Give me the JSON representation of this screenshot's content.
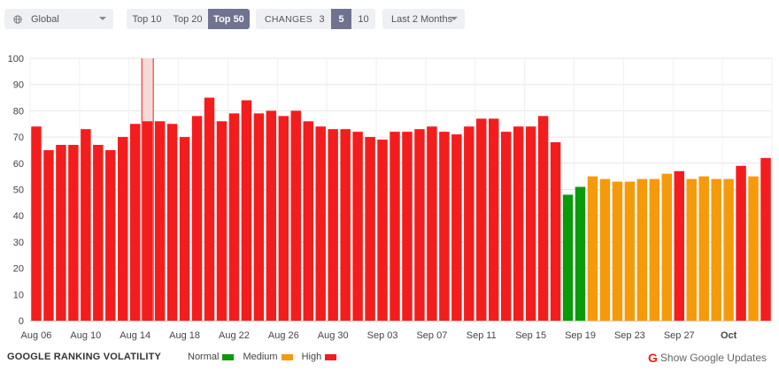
{
  "controls": {
    "region": {
      "label": "Global",
      "icon": "globe-icon"
    },
    "top_options": [
      {
        "label": "Top 10",
        "active": false
      },
      {
        "label": "Top 20",
        "active": false
      },
      {
        "label": "Top 50",
        "active": true
      }
    ],
    "changes": {
      "label": "CHANGES",
      "options": [
        {
          "label": "3",
          "active": false
        },
        {
          "label": "5",
          "active": true
        },
        {
          "label": "10",
          "active": false
        }
      ]
    },
    "period": {
      "label": "Last 2 Months"
    }
  },
  "colors": {
    "normal": "#0a9a0a",
    "medium": "#f59a0a",
    "high": "#f31d1d",
    "highlight": "#f5dada",
    "grid": "#e6e6e6"
  },
  "chart_data": {
    "type": "bar",
    "title": "GOOGLE RANKING VOLATILITY",
    "ylim": [
      0,
      100
    ],
    "yticks": [
      0,
      10,
      20,
      30,
      40,
      50,
      60,
      70,
      80,
      90,
      100
    ],
    "grid": true,
    "values": [
      74,
      65,
      67,
      67,
      73,
      67,
      65,
      70,
      75,
      76,
      76,
      75,
      70,
      78,
      85,
      76,
      79,
      84,
      79,
      80,
      78,
      80,
      76,
      74,
      73,
      73,
      72,
      70,
      69,
      72,
      72,
      73,
      74,
      72,
      71,
      74,
      77,
      77,
      72,
      74,
      74,
      78,
      68,
      48,
      51,
      55,
      54,
      53,
      53,
      54,
      54,
      56,
      57,
      54,
      55,
      54,
      54,
      59,
      55,
      62
    ],
    "levels": [
      "high",
      "high",
      "high",
      "high",
      "high",
      "high",
      "high",
      "high",
      "high",
      "high",
      "high",
      "high",
      "high",
      "high",
      "high",
      "high",
      "high",
      "high",
      "high",
      "high",
      "high",
      "high",
      "high",
      "high",
      "high",
      "high",
      "high",
      "high",
      "high",
      "high",
      "high",
      "high",
      "high",
      "high",
      "high",
      "high",
      "high",
      "high",
      "high",
      "high",
      "high",
      "high",
      "high",
      "normal",
      "normal",
      "medium",
      "medium",
      "medium",
      "medium",
      "medium",
      "medium",
      "medium",
      "high",
      "medium",
      "medium",
      "medium",
      "medium",
      "high",
      "medium",
      "high"
    ],
    "x_labels": [
      {
        "index": 0,
        "label": "Aug 06"
      },
      {
        "index": 4,
        "label": "Aug 10"
      },
      {
        "index": 8,
        "label": "Aug 14"
      },
      {
        "index": 12,
        "label": "Aug 18"
      },
      {
        "index": 16,
        "label": "Aug 22"
      },
      {
        "index": 20,
        "label": "Aug 26"
      },
      {
        "index": 24,
        "label": "Aug 30"
      },
      {
        "index": 28,
        "label": "Sep 03"
      },
      {
        "index": 32,
        "label": "Sep 07"
      },
      {
        "index": 36,
        "label": "Sep 11"
      },
      {
        "index": 40,
        "label": "Sep 15"
      },
      {
        "index": 44,
        "label": "Sep 19"
      },
      {
        "index": 48,
        "label": "Sep 23"
      },
      {
        "index": 52,
        "label": "Sep 27"
      },
      {
        "index": 56,
        "label": "Oct",
        "bold": true
      }
    ],
    "highlight_index": 9,
    "legend": [
      {
        "label": "Normal",
        "key": "normal"
      },
      {
        "label": "Medium",
        "key": "medium"
      },
      {
        "label": "High",
        "key": "high"
      }
    ]
  },
  "footer": {
    "show_updates_label": "Show Google Updates",
    "google_glyph": "G"
  }
}
